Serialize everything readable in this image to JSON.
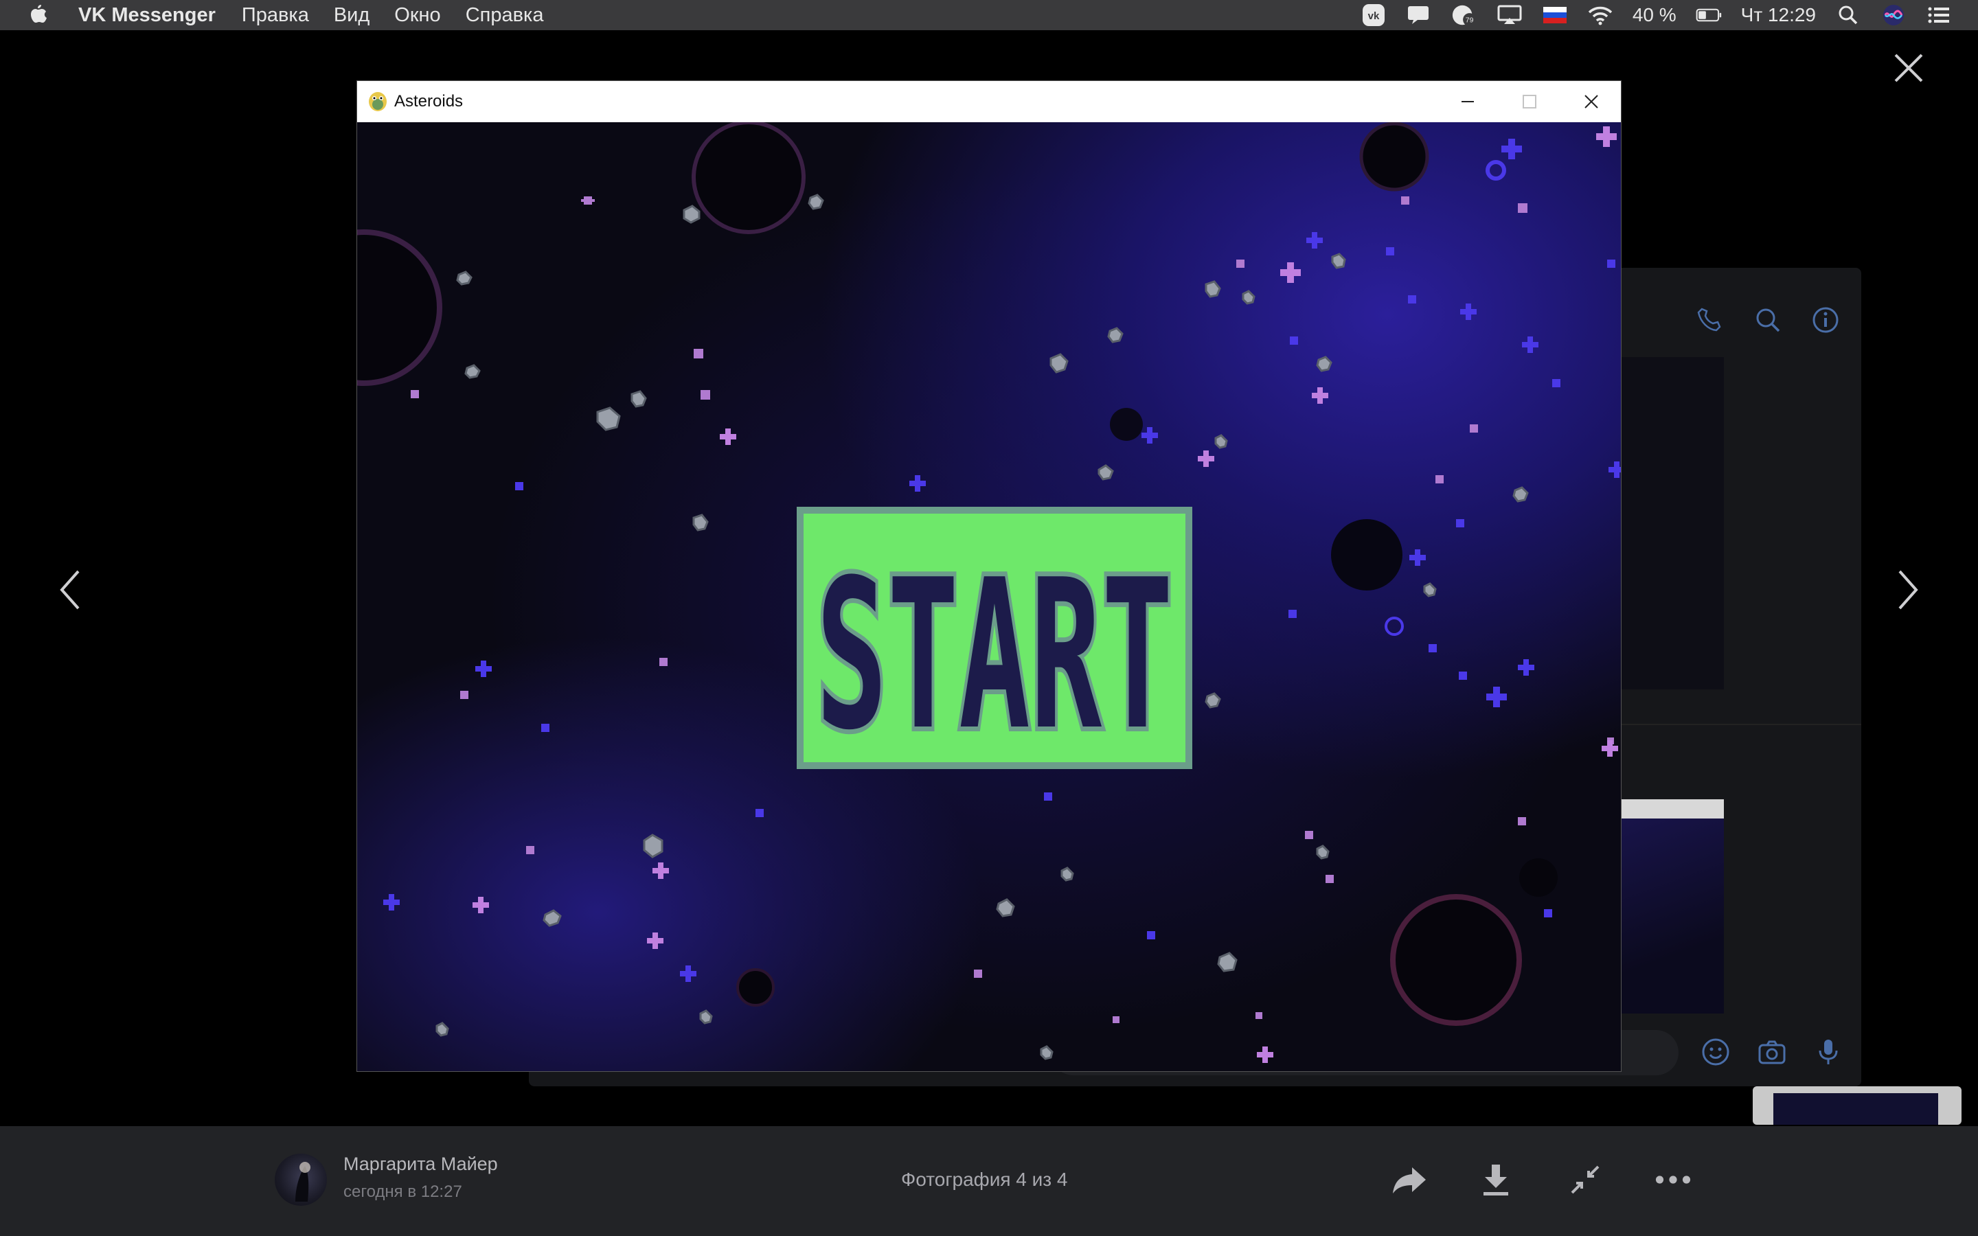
{
  "menubar": {
    "app_name": "VK Messenger",
    "menus": [
      "Правка",
      "Вид",
      "Окно",
      "Справка"
    ],
    "battery_percent": "40 %",
    "clock": "Чт 12:29",
    "notification_badge": "79",
    "status_icons": [
      "vk-icon",
      "notification-icon",
      "badge-icon",
      "airplay-icon",
      "flag-ru-icon",
      "wifi-icon",
      "battery-icon",
      "search-icon",
      "siri-icon",
      "menu-list-icon"
    ]
  },
  "game_window": {
    "title": "Asteroids",
    "start_label": "START"
  },
  "viewer": {
    "author_name": "Маргарита Майер",
    "post_time": "сегодня в 12:27",
    "photo_counter": "Фотография 4 из 4"
  },
  "colors": {
    "start_green": "#6ee86a",
    "start_frame": "#6b9e8a",
    "start_text": "#1c1b4a",
    "space_blue": "#2b1f9a",
    "menubar_bg": "#3a3a3c",
    "bottombar_bg": "#222326"
  }
}
